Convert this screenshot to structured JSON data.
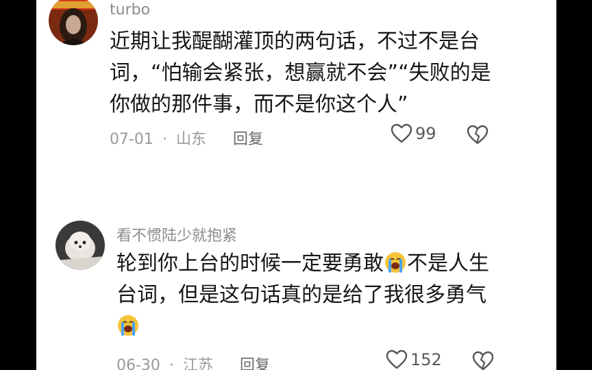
{
  "comments": [
    {
      "username": "turbo",
      "lines": [
        "近期让我醍醐灌顶的两句话，不过不是台",
        "词，“怕输会紧张，想赢就不会”“失败的是",
        "你做的那件事，而不是你这个人”"
      ],
      "date": "07-01",
      "location": "山东",
      "reply_label": "回复",
      "likes": "99"
    },
    {
      "username": "看不惯陆少就抱紧",
      "line1_part1": "轮到你上台的时候一定要勇敢",
      "line1_part2": "不是人生",
      "line2": "台词，但是这句话真的是给了我很多勇气",
      "date": "06-30",
      "location": "江苏",
      "reply_label": "回复",
      "likes": "152"
    }
  ],
  "meta_separator": "·",
  "icons": [
    "heart-outline-icon",
    "broken-heart-icon",
    "crying-face-emoji"
  ]
}
